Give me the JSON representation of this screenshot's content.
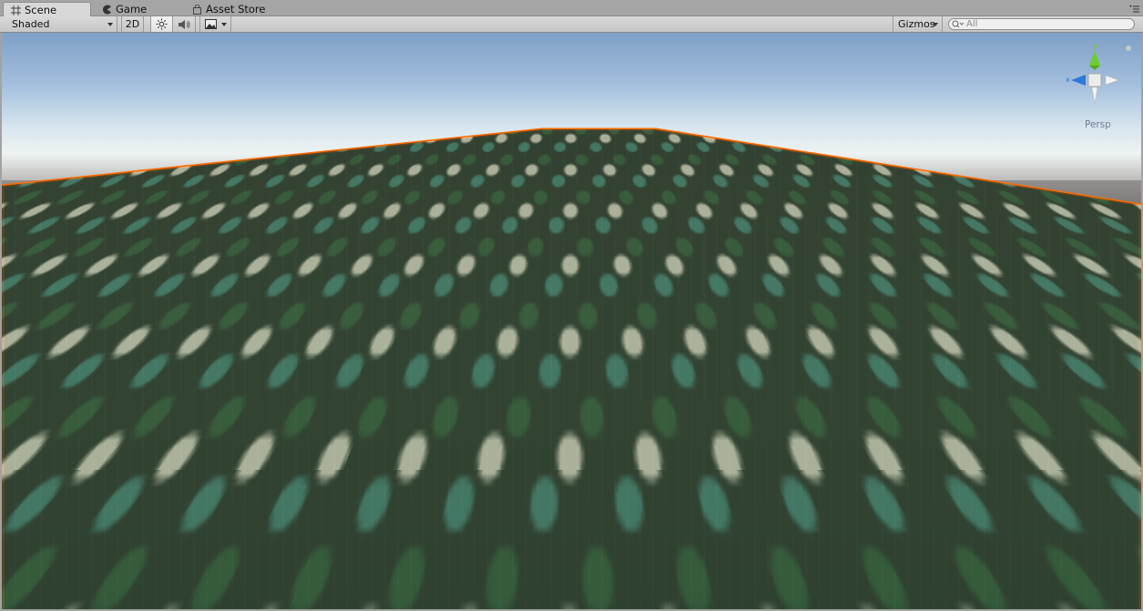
{
  "tabs": [
    {
      "label": "Scene",
      "icon": "scene-grid-icon",
      "active": true
    },
    {
      "label": "Game",
      "icon": "game-pacman-icon",
      "active": false
    },
    {
      "label": "Asset Store",
      "icon": "asset-store-bag-icon",
      "active": false
    }
  ],
  "toolbar": {
    "draw_mode": "Shaded",
    "mode_2d": "2D",
    "lighting_icon": "sun-icon",
    "audio_icon": "speaker-icon",
    "effects_icon": "image-icon",
    "gizmos_label": "Gizmos",
    "search_placeholder": "All"
  },
  "viewport": {
    "projection_label": "Persp",
    "gizmo_axis_label": "y",
    "selection_outline_color": "#ff6a00",
    "gizmo_colors": {
      "y": "#6ccd2c",
      "x": "#2f78d8",
      "neutral": "#ffffff"
    }
  }
}
